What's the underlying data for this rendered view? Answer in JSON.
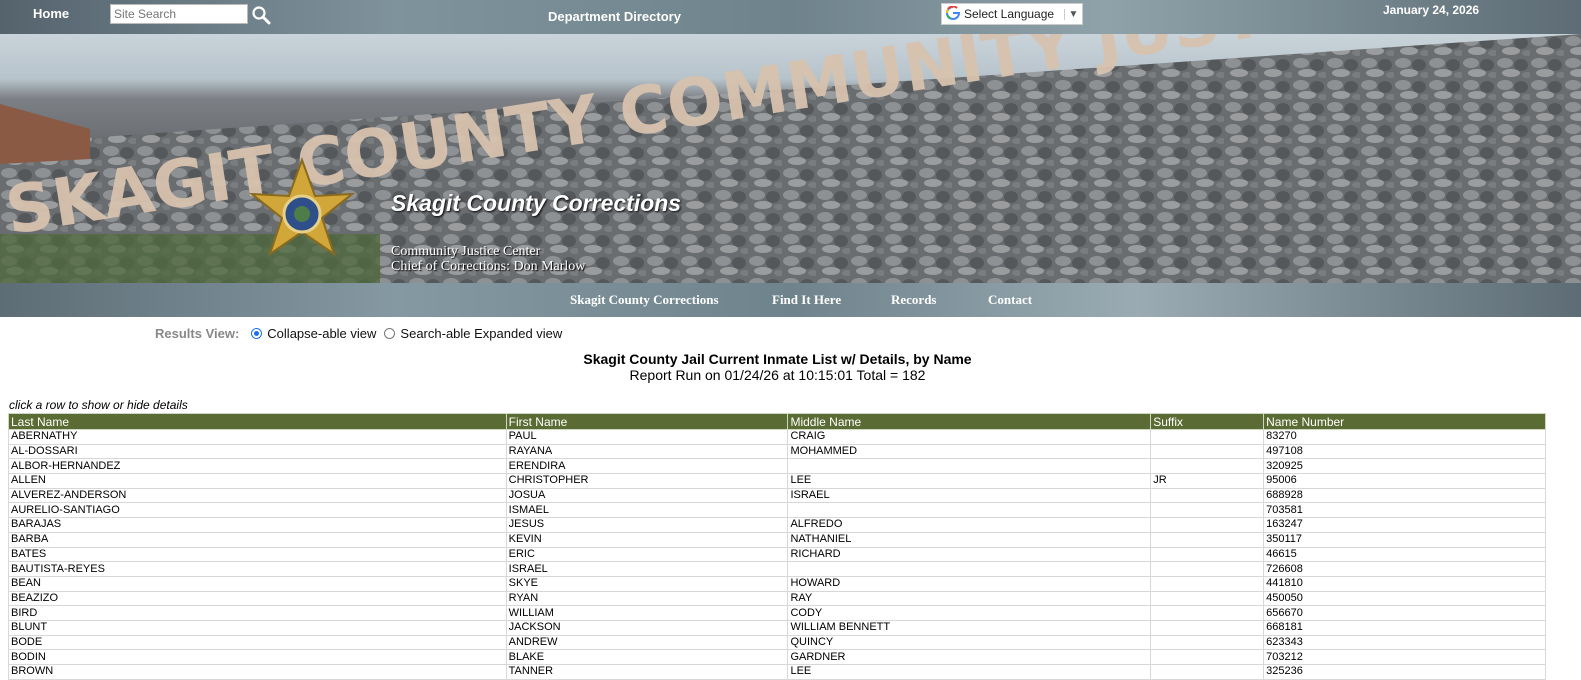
{
  "topbar": {
    "home": "Home",
    "search_placeholder": "Site Search",
    "directory": "Department Directory",
    "language": "Select Language",
    "date": "January 24, 2026"
  },
  "banner": {
    "sign_text": "SKAGIT COUNTY COMMUNITY JUSTICE CENTER",
    "title": "Skagit County Corrections",
    "line1": "Community Justice Center",
    "line2": "Chief of Corrections: Don Marlow"
  },
  "nav": [
    "Skagit County Corrections",
    "Find It Here",
    "Records",
    "Contact"
  ],
  "results_view": {
    "label": "Results View:",
    "options": [
      "Collapse-able view",
      "Search-able Expanded view"
    ],
    "selected": 0
  },
  "report": {
    "title": "Skagit County Jail Current Inmate List w/ Details, by Name",
    "run": "Report Run on 01/24/26 at 10:15:01 Total = 182",
    "hint": "click a row to show or hide details"
  },
  "table": {
    "headers": [
      "Last Name",
      "First Name",
      "Middle Name",
      "Suffix",
      "Name Number"
    ],
    "rows": [
      [
        "ABERNATHY",
        "PAUL",
        "CRAIG",
        "",
        "83270"
      ],
      [
        "AL-DOSSARI",
        "RAYANA",
        "MOHAMMED",
        "",
        "497108"
      ],
      [
        "ALBOR-HERNANDEZ",
        "ERENDIRA",
        "",
        "",
        "320925"
      ],
      [
        "ALLEN",
        "CHRISTOPHER",
        "LEE",
        "JR",
        "95006"
      ],
      [
        "ALVEREZ-ANDERSON",
        "JOSUA",
        "ISRAEL",
        "",
        "688928"
      ],
      [
        "AURELIO-SANTIAGO",
        "ISMAEL",
        "",
        "",
        "703581"
      ],
      [
        "BARAJAS",
        "JESUS",
        "ALFREDO",
        "",
        "163247"
      ],
      [
        "BARBA",
        "KEVIN",
        "NATHANIEL",
        "",
        "350117"
      ],
      [
        "BATES",
        "ERIC",
        "RICHARD",
        "",
        "46615"
      ],
      [
        "BAUTISTA-REYES",
        "ISRAEL",
        "",
        "",
        "726608"
      ],
      [
        "BEAN",
        "SKYE",
        "HOWARD",
        "",
        "441810"
      ],
      [
        "BEAZIZO",
        "RYAN",
        "RAY",
        "",
        "450050"
      ],
      [
        "BIRD",
        "WILLIAM",
        "CODY",
        "",
        "656670"
      ],
      [
        "BLUNT",
        "JACKSON",
        "WILLIAM BENNETT",
        "",
        "668181"
      ],
      [
        "BODE",
        "ANDREW",
        "QUINCY",
        "",
        "623343"
      ],
      [
        "BODIN",
        "BLAKE",
        "GARDNER",
        "",
        "703212"
      ],
      [
        "BROWN",
        "TANNER",
        "LEE",
        "",
        "325236"
      ]
    ]
  }
}
